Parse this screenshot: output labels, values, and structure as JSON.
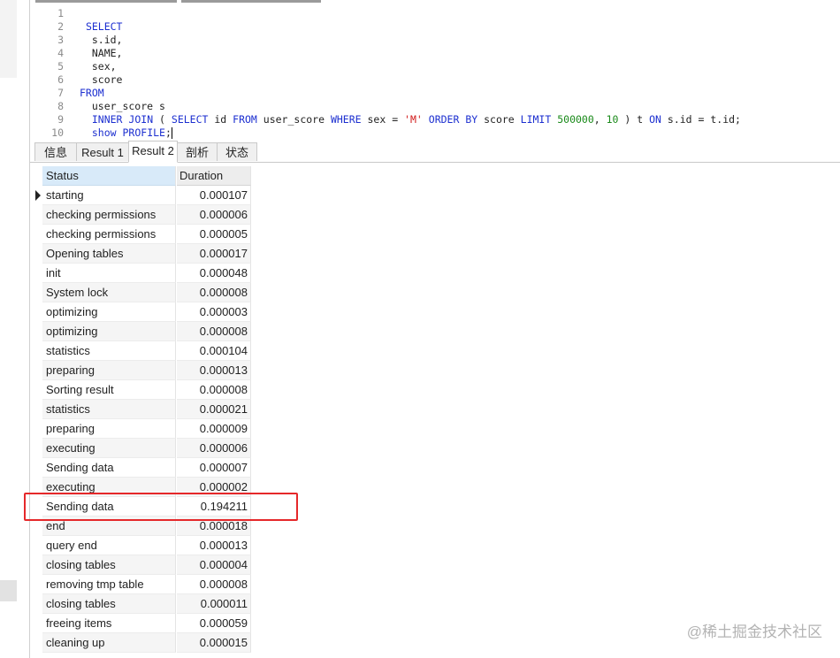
{
  "editor": {
    "lines": [
      {
        "n": "1",
        "code": ""
      },
      {
        "n": "2",
        "code": " SELECT"
      },
      {
        "n": "3",
        "code": "  s.id,"
      },
      {
        "n": "4",
        "code": "  NAME,"
      },
      {
        "n": "5",
        "code": "  sex,"
      },
      {
        "n": "6",
        "code": "  score"
      },
      {
        "n": "7",
        "code": "FROM"
      },
      {
        "n": "8",
        "code": "  user_score s"
      },
      {
        "n": "9",
        "code": "  INNER JOIN ( SELECT id FROM user_score WHERE sex = 'M' ORDER BY score LIMIT 500000, 10 ) t ON s.id = t.id;"
      },
      {
        "n": "10",
        "code": "  show PROFILE;"
      }
    ]
  },
  "tabs": [
    {
      "label": "信息",
      "active": false
    },
    {
      "label": "Result 1",
      "active": false
    },
    {
      "label": "Result 2",
      "active": true
    },
    {
      "label": "剖析",
      "active": false
    },
    {
      "label": "状态",
      "active": false
    }
  ],
  "table": {
    "columns": [
      "Status",
      "Duration"
    ],
    "rows": [
      [
        "starting",
        "0.000107"
      ],
      [
        "checking permissions",
        "0.000006"
      ],
      [
        "checking permissions",
        "0.000005"
      ],
      [
        "Opening tables",
        "0.000017"
      ],
      [
        "init",
        "0.000048"
      ],
      [
        "System lock",
        "0.000008"
      ],
      [
        "optimizing",
        "0.000003"
      ],
      [
        "optimizing",
        "0.000008"
      ],
      [
        "statistics",
        "0.000104"
      ],
      [
        "preparing",
        "0.000013"
      ],
      [
        "Sorting result",
        "0.000008"
      ],
      [
        "statistics",
        "0.000021"
      ],
      [
        "preparing",
        "0.000009"
      ],
      [
        "executing",
        "0.000006"
      ],
      [
        "Sending data",
        "0.000007"
      ],
      [
        "executing",
        "0.000002"
      ],
      [
        "Sending data",
        "0.194211"
      ],
      [
        "end",
        "0.000018"
      ],
      [
        "query end",
        "0.000013"
      ],
      [
        "closing tables",
        "0.000004"
      ],
      [
        "removing tmp table",
        "0.000008"
      ],
      [
        "closing tables",
        "0.000011"
      ],
      [
        "freeing items",
        "0.000059"
      ],
      [
        "cleaning up",
        "0.000015"
      ]
    ]
  },
  "watermark": "@稀土掘金技术社区",
  "colors": {
    "keyword": "#1c2fd0",
    "string": "#d11b1b",
    "number": "#1a8a1a",
    "highlight_border": "#e5282a",
    "header_bg": "#d8eaf9"
  }
}
